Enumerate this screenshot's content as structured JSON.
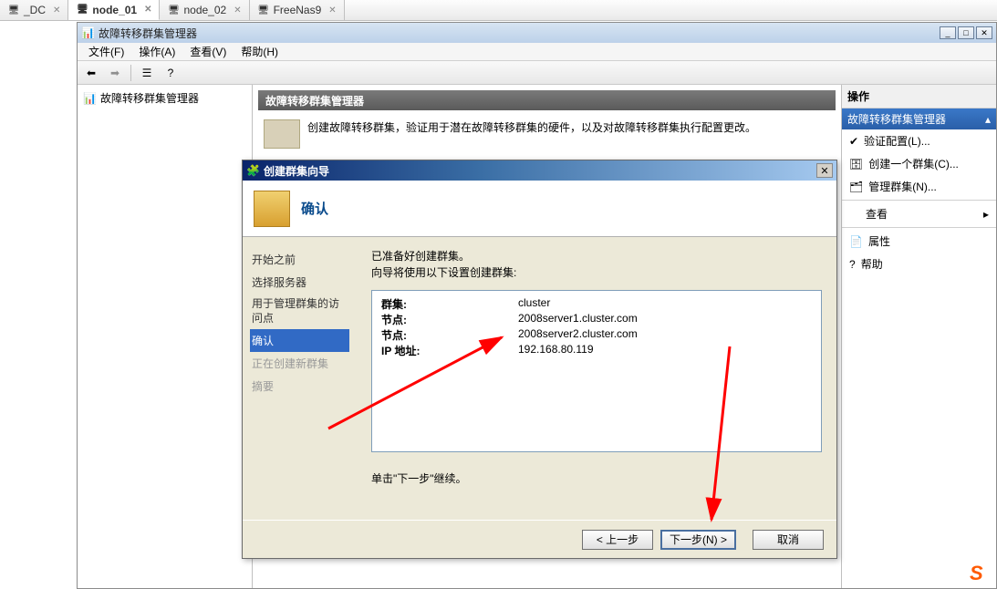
{
  "tabs": [
    {
      "label": "_DC"
    },
    {
      "label": "node_01",
      "active": true
    },
    {
      "label": "node_02"
    },
    {
      "label": "FreeNas9"
    }
  ],
  "app": {
    "title": "故障转移群集管理器",
    "menus": [
      "文件(F)",
      "操作(A)",
      "查看(V)",
      "帮助(H)"
    ]
  },
  "tree": {
    "root": "故障转移群集管理器"
  },
  "center": {
    "header": "故障转移群集管理器",
    "desc": "创建故障转移群集，验证用于潜在故障转移群集的硬件，以及对故障转移群集执行配置更改。"
  },
  "actions": {
    "title": "操作",
    "subtitle": "故障转移群集管理器",
    "items": [
      "验证配置(L)...",
      "创建一个群集(C)...",
      "管理群集(N)...",
      "查看",
      "属性",
      "帮助"
    ]
  },
  "wizard": {
    "title": "创建群集向导",
    "header": "确认",
    "steps": [
      "开始之前",
      "选择服务器",
      "用于管理群集的访问点",
      "确认",
      "正在创建新群集",
      "摘要"
    ],
    "intro1": "已准备好创建群集。",
    "intro2": "向导将使用以下设置创建群集:",
    "rows": [
      {
        "k": "群集:",
        "v": "cluster"
      },
      {
        "k": "节点:",
        "v": "2008server1.cluster.com"
      },
      {
        "k": "节点:",
        "v": "2008server2.cluster.com"
      },
      {
        "k": "IP 地址:",
        "v": "192.168.80.119"
      }
    ],
    "hint": "单击\"下一步\"继续。",
    "buttons": {
      "back": "< 上一步",
      "next": "下一步(N) >",
      "cancel": "取消"
    }
  }
}
